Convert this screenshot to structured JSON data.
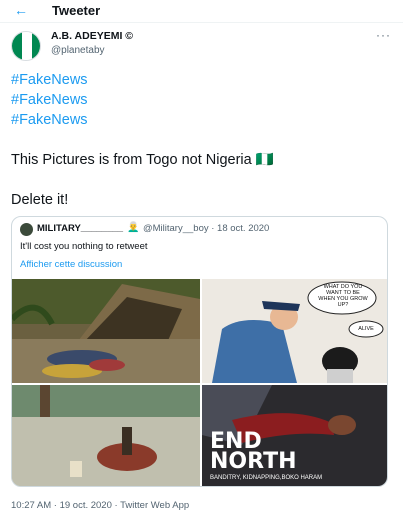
{
  "header": {
    "back_icon": "arrow-left-icon",
    "title": "Tweeter"
  },
  "author": {
    "name": "A.B. ADEYEMI ©",
    "handle": "@planetaby",
    "avatar": "nigeria-flag-avatar",
    "more_icon": "more-icon"
  },
  "tweet": {
    "hashtags": [
      "#FakeNews",
      "#FakeNews",
      "#FakeNews"
    ],
    "line1": "This Pictures is from Togo not Nigeria 🇳🇬",
    "line2": "Delete it!"
  },
  "quote": {
    "name": "MILITARY________",
    "emoji": "👨‍🦳",
    "meta": "@Military__boy · 18 oct. 2020",
    "text": "It'll cost you nothing to retweet",
    "link": "Afficher cette discussion",
    "photos": [
      {
        "name": "photo-huts-bodies"
      },
      {
        "name": "photo-cartoon-police",
        "bubble1": "WHAT DO YOU WANT TO BE WHEN YOU GROW UP?",
        "bubble2": "ALIVE"
      },
      {
        "name": "photo-victim-ground"
      },
      {
        "name": "photo-end-north",
        "title_line1": "END",
        "title_line2": "NORTH",
        "caption": "BANDITRY, KIDNAPPING,BOKO HARAM"
      }
    ]
  },
  "footer": {
    "timestamp": "10:27 AM · 19 oct. 2020 · Twitter Web App"
  },
  "colors": {
    "accent": "#1d9bf0",
    "text": "#0f1419",
    "muted": "#536471",
    "border": "#cfd9de"
  }
}
